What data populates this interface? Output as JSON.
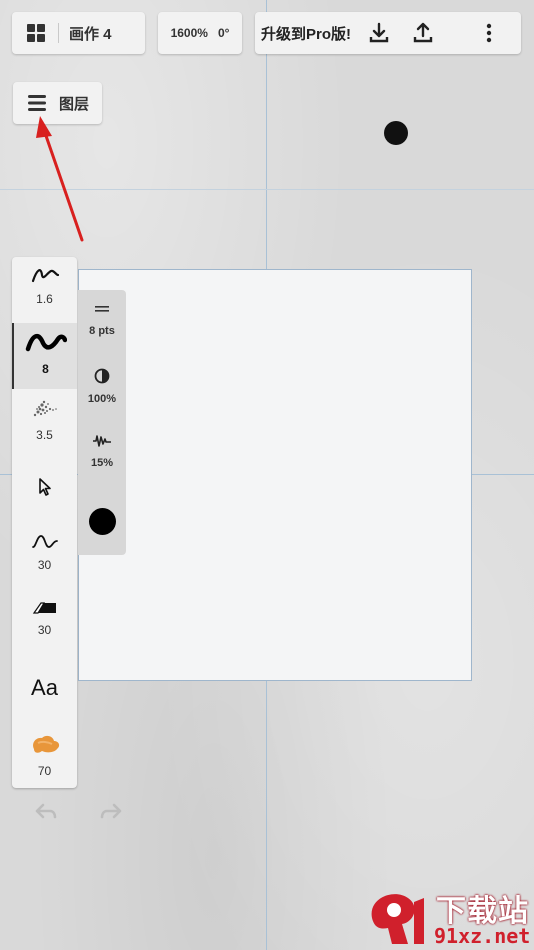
{
  "header": {
    "drawing_title": "画作 4",
    "zoom": "1600%",
    "rotation": "0°",
    "upgrade_label": "升级到Pro版!"
  },
  "layers_button": {
    "label": "图层"
  },
  "toolbar": {
    "tools": [
      {
        "id": "pencil",
        "value": "1.6",
        "icon": "pencil-stroke-icon"
      },
      {
        "id": "brush",
        "value": "8",
        "icon": "brush-stroke-icon",
        "active": true
      },
      {
        "id": "airbrush",
        "value": "3.5",
        "icon": "airbrush-icon"
      },
      {
        "id": "select",
        "value": "",
        "icon": "selection-cursor-icon"
      },
      {
        "id": "curve",
        "value": "30",
        "icon": "curve-icon"
      },
      {
        "id": "eraser",
        "value": "30",
        "icon": "eraser-icon"
      },
      {
        "id": "text",
        "value": "",
        "icon": "text-tool-icon",
        "label": "Aa"
      },
      {
        "id": "fill",
        "value": "70",
        "icon": "paint-smudge-icon"
      }
    ]
  },
  "brush_props": {
    "size": "8 pts",
    "opacity": "100%",
    "flow": "15%",
    "color": "#000000"
  },
  "watermark": {
    "top": "下载站",
    "bottom": "91xz.net"
  },
  "colors": {
    "accent": "#111111",
    "guide": "#a9c1d6",
    "annotation_arrow": "#d8201f",
    "smudge": "#e8963a",
    "watermark_red": "#d0202c"
  }
}
